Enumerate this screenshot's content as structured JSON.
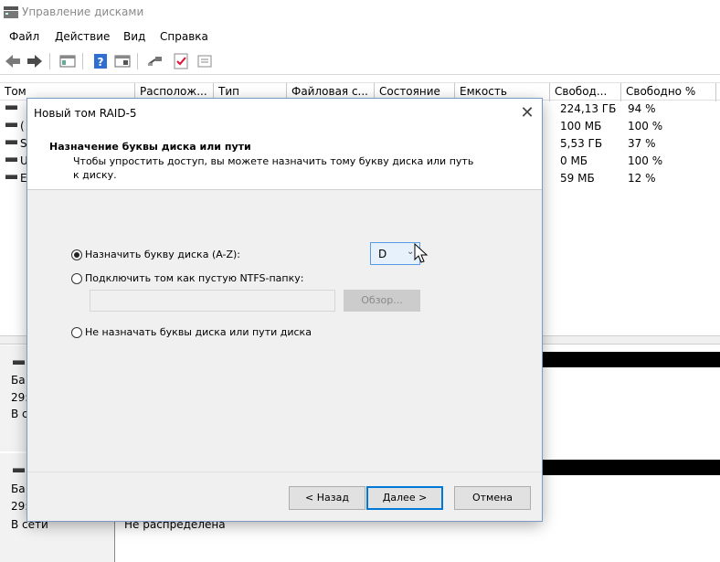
{
  "window": {
    "title": "Управление дисками"
  },
  "menu": [
    "Файл",
    "Действие",
    "Вид",
    "Справка"
  ],
  "toolbar": {
    "icons": [
      "back-arrow-icon",
      "forward-arrow-icon",
      "console-tree-icon",
      "help-icon",
      "details-pane-icon",
      "key-icon",
      "checklist-icon",
      "properties-icon"
    ]
  },
  "volumes": {
    "columns": [
      "Том",
      "Располож...",
      "Тип",
      "Файловая с...",
      "Состояние",
      "Емкость",
      "Свобод...",
      "Свободно %"
    ],
    "rows": [
      {
        "letter": "",
        "free": "224,13 ГБ",
        "free_pct": "94 %"
      },
      {
        "letter": "(",
        "free": "100 МБ",
        "free_pct": "100 %"
      },
      {
        "letter": "S",
        "free": "5,53 ГБ",
        "free_pct": "37 %"
      },
      {
        "letter": "U",
        "free": "0 МБ",
        "free_pct": "100 %"
      },
      {
        "letter": "E",
        "free": "59 МБ",
        "free_pct": "12 %"
      }
    ]
  },
  "disks": [
    {
      "line1": "Ба:",
      "line2": "29:",
      "line3": "В с"
    },
    {
      "line1": "Ба:",
      "line2": "29:",
      "line3": "В сети"
    }
  ],
  "unallocated_label": "Не распределена",
  "dialog": {
    "title": "Новый том RAID-5",
    "heading": "Назначение буквы диска или пути",
    "description_line1": "Чтобы упростить доступ, вы можете назначить тому букву диска или путь",
    "description_line2": "к диску.",
    "options": {
      "assign_letter": "Назначить букву диска (A-Z):",
      "mount_folder": "Подключить том как пустую NTFS-папку:",
      "no_letter": "Не назначать буквы диска или пути диска"
    },
    "drive_letter": "D",
    "browse_label": "Обзор...",
    "buttons": {
      "back": "< Назад",
      "next": "Далее >",
      "cancel": "Отмена"
    }
  }
}
